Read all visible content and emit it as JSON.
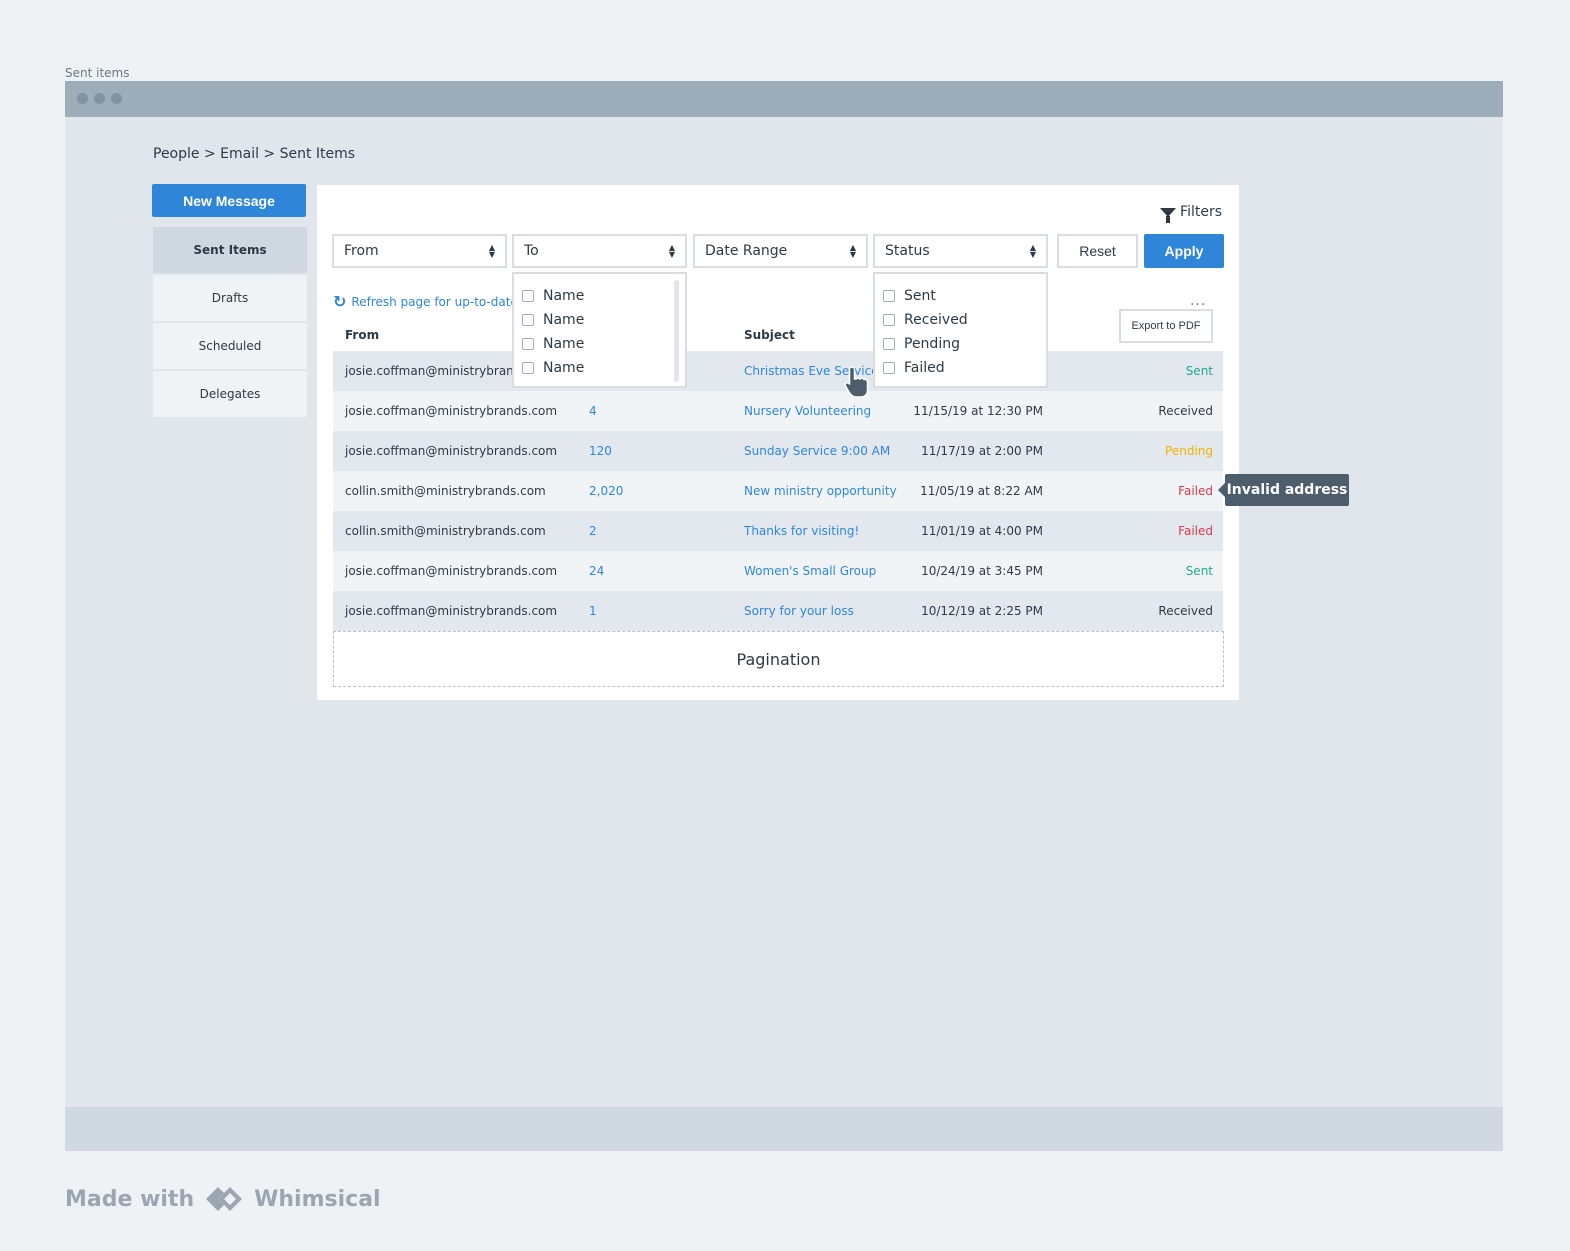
{
  "frame": {
    "title": "Sent items"
  },
  "breadcrumb": "People > Email > Sent Items",
  "sidebar": {
    "new_message_label": "New Message",
    "items": [
      {
        "label": "Sent Items",
        "active": true
      },
      {
        "label": "Drafts"
      },
      {
        "label": "Scheduled"
      },
      {
        "label": "Delegates"
      }
    ]
  },
  "toolbar": {
    "filters_label": "Filters",
    "selects": {
      "from": "From",
      "to": "To",
      "date_range": "Date Range",
      "status": "Status"
    },
    "reset_label": "Reset",
    "apply_label": "Apply",
    "refresh_label": "Refresh page for up-to-date",
    "more_label": "...",
    "export_label": "Export to PDF"
  },
  "table": {
    "headers": {
      "from": "From",
      "subject": "Subject"
    },
    "rows": [
      {
        "from": "josie.coffman@ministrybrands.com",
        "to": "",
        "subject": "Christmas Eve Service",
        "date": "",
        "status": "Sent"
      },
      {
        "from": "josie.coffman@ministrybrands.com",
        "to": "4",
        "subject": "Nursery Volunteering",
        "date": "11/15/19 at 12:30 PM",
        "status": "Received"
      },
      {
        "from": "josie.coffman@ministrybrands.com",
        "to": "120",
        "subject": "Sunday Service 9:00 AM",
        "date": "11/17/19 at 2:00 PM",
        "status": "Pending"
      },
      {
        "from": "collin.smith@ministrybrands.com",
        "to": "2,020",
        "subject": "New ministry opportunity",
        "date": "11/05/19 at 8:22 AM",
        "status": "Failed"
      },
      {
        "from": "collin.smith@ministrybrands.com",
        "to": "2",
        "subject": "Thanks for visiting!",
        "date": "11/01/19 at 4:00 PM",
        "status": "Failed"
      },
      {
        "from": "josie.coffman@ministrybrands.com",
        "to": "24",
        "subject": "Women's Small Group",
        "date": "10/24/19 at 3:45 PM",
        "status": "Sent"
      },
      {
        "from": "josie.coffman@ministrybrands.com",
        "to": "1",
        "subject": "Sorry for your loss",
        "date": "10/12/19 at 2:25 PM",
        "status": "Received"
      }
    ],
    "pagination_label": "Pagination"
  },
  "to_dropdown": {
    "options": [
      "Name",
      "Name",
      "Name",
      "Name"
    ]
  },
  "status_dropdown": {
    "options": [
      "Sent",
      "Received",
      "Pending",
      "Failed"
    ]
  },
  "tooltip": "Invalid address",
  "branding": {
    "made_with": "Made with",
    "brand": "Whimsical"
  },
  "colors": {
    "accent": "#2f86d8",
    "sent": "#20a98e",
    "pending": "#f0b400",
    "failed": "#d6394e"
  }
}
